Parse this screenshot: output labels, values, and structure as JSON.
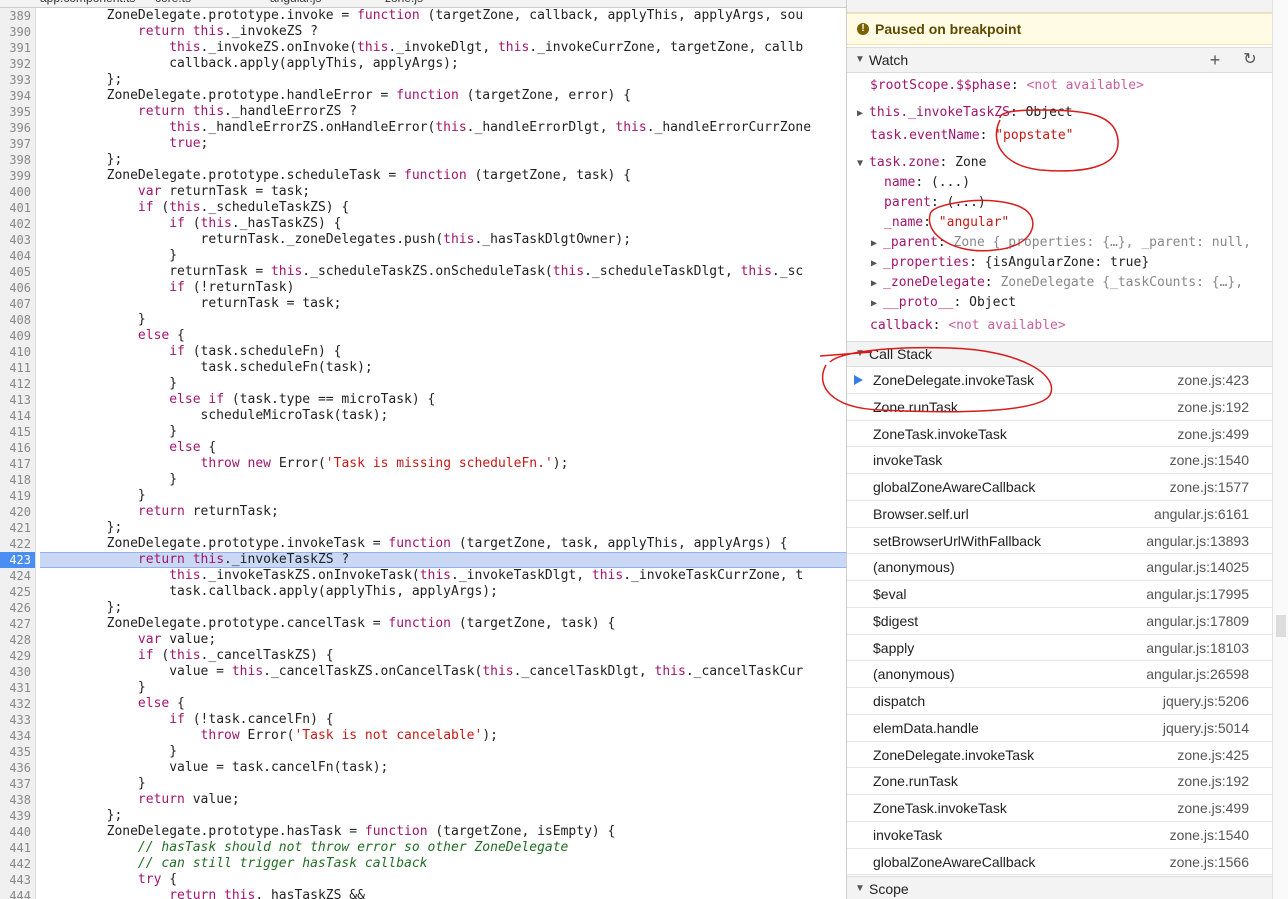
{
  "editor": {
    "tabs": [
      "app.component.ts",
      "core.ts",
      "angular.js",
      "zone.js"
    ],
    "current_line": "423",
    "lines": [
      {
        "n": "389",
        "segs": [
          [
            "fn",
            "        "
          ],
          [
            "fn",
            "ZoneDelegate.prototype.invoke = "
          ],
          [
            "kw",
            "function"
          ],
          [
            "fn",
            " (targetZone, callback, applyThis, applyArgs, sou"
          ]
        ]
      },
      {
        "n": "390",
        "segs": [
          [
            "fn",
            "            "
          ],
          [
            "kw",
            "return"
          ],
          [
            "fn",
            " "
          ],
          [
            "kw",
            "this"
          ],
          [
            "fn",
            "._invokeZS ?"
          ]
        ]
      },
      {
        "n": "391",
        "segs": [
          [
            "fn",
            "                "
          ],
          [
            "kw",
            "this"
          ],
          [
            "fn",
            "._invokeZS.onInvoke("
          ],
          [
            "kw",
            "this"
          ],
          [
            "fn",
            "._invokeDlgt, "
          ],
          [
            "kw",
            "this"
          ],
          [
            "fn",
            "._invokeCurrZone, targetZone, callb"
          ]
        ]
      },
      {
        "n": "392",
        "segs": [
          [
            "fn",
            "                callback.apply(applyThis, applyArgs);"
          ]
        ]
      },
      {
        "n": "393",
        "segs": [
          [
            "fn",
            "        };"
          ]
        ]
      },
      {
        "n": "394",
        "segs": [
          [
            "fn",
            "        ZoneDelegate.prototype.handleError = "
          ],
          [
            "kw",
            "function"
          ],
          [
            "fn",
            " (targetZone, error) {"
          ]
        ]
      },
      {
        "n": "395",
        "segs": [
          [
            "fn",
            "            "
          ],
          [
            "kw",
            "return"
          ],
          [
            "fn",
            " "
          ],
          [
            "kw",
            "this"
          ],
          [
            "fn",
            "._handleErrorZS ?"
          ]
        ]
      },
      {
        "n": "396",
        "segs": [
          [
            "fn",
            "                "
          ],
          [
            "kw",
            "this"
          ],
          [
            "fn",
            "._handleErrorZS.onHandleError("
          ],
          [
            "kw",
            "this"
          ],
          [
            "fn",
            "._handleErrorDlgt, "
          ],
          [
            "kw",
            "this"
          ],
          [
            "fn",
            "._handleErrorCurrZone"
          ]
        ]
      },
      {
        "n": "397",
        "segs": [
          [
            "fn",
            "                "
          ],
          [
            "kw",
            "true"
          ],
          [
            "fn",
            ";"
          ]
        ]
      },
      {
        "n": "398",
        "segs": [
          [
            "fn",
            "        };"
          ]
        ]
      },
      {
        "n": "399",
        "segs": [
          [
            "fn",
            "        ZoneDelegate.prototype.scheduleTask = "
          ],
          [
            "kw",
            "function"
          ],
          [
            "fn",
            " (targetZone, task) {"
          ]
        ]
      },
      {
        "n": "400",
        "segs": [
          [
            "fn",
            "            "
          ],
          [
            "kw",
            "var"
          ],
          [
            "fn",
            " returnTask = task;"
          ]
        ]
      },
      {
        "n": "401",
        "segs": [
          [
            "fn",
            "            "
          ],
          [
            "kw",
            "if"
          ],
          [
            "fn",
            " ("
          ],
          [
            "kw",
            "this"
          ],
          [
            "fn",
            "._scheduleTaskZS) {"
          ]
        ]
      },
      {
        "n": "402",
        "segs": [
          [
            "fn",
            "                "
          ],
          [
            "kw",
            "if"
          ],
          [
            "fn",
            " ("
          ],
          [
            "kw",
            "this"
          ],
          [
            "fn",
            "._hasTaskZS) {"
          ]
        ]
      },
      {
        "n": "403",
        "segs": [
          [
            "fn",
            "                    returnTask._zoneDelegates.push("
          ],
          [
            "kw",
            "this"
          ],
          [
            "fn",
            "._hasTaskDlgtOwner);"
          ]
        ]
      },
      {
        "n": "404",
        "segs": [
          [
            "fn",
            "                }"
          ]
        ]
      },
      {
        "n": "405",
        "segs": [
          [
            "fn",
            "                returnTask = "
          ],
          [
            "kw",
            "this"
          ],
          [
            "fn",
            "._scheduleTaskZS.onScheduleTask("
          ],
          [
            "kw",
            "this"
          ],
          [
            "fn",
            "._scheduleTaskDlgt, "
          ],
          [
            "kw",
            "this"
          ],
          [
            "fn",
            "._sc"
          ]
        ]
      },
      {
        "n": "406",
        "segs": [
          [
            "fn",
            "                "
          ],
          [
            "kw",
            "if"
          ],
          [
            "fn",
            " (!returnTask)"
          ]
        ]
      },
      {
        "n": "407",
        "segs": [
          [
            "fn",
            "                    returnTask = task;"
          ]
        ]
      },
      {
        "n": "408",
        "segs": [
          [
            "fn",
            "            }"
          ]
        ]
      },
      {
        "n": "409",
        "segs": [
          [
            "fn",
            "            "
          ],
          [
            "kw",
            "else"
          ],
          [
            "fn",
            " {"
          ]
        ]
      },
      {
        "n": "410",
        "segs": [
          [
            "fn",
            "                "
          ],
          [
            "kw",
            "if"
          ],
          [
            "fn",
            " (task.scheduleFn) {"
          ]
        ]
      },
      {
        "n": "411",
        "segs": [
          [
            "fn",
            "                    task.scheduleFn(task);"
          ]
        ]
      },
      {
        "n": "412",
        "segs": [
          [
            "fn",
            "                }"
          ]
        ]
      },
      {
        "n": "413",
        "segs": [
          [
            "fn",
            "                "
          ],
          [
            "kw",
            "else if"
          ],
          [
            "fn",
            " (task.type == microTask) {"
          ]
        ]
      },
      {
        "n": "414",
        "segs": [
          [
            "fn",
            "                    scheduleMicroTask(task);"
          ]
        ]
      },
      {
        "n": "415",
        "segs": [
          [
            "fn",
            "                }"
          ]
        ]
      },
      {
        "n": "416",
        "segs": [
          [
            "fn",
            "                "
          ],
          [
            "kw",
            "else"
          ],
          [
            "fn",
            " {"
          ]
        ]
      },
      {
        "n": "417",
        "segs": [
          [
            "fn",
            "                    "
          ],
          [
            "kw",
            "throw new"
          ],
          [
            "fn",
            " Error("
          ],
          [
            "str",
            "'Task is missing scheduleFn.'"
          ],
          [
            "fn",
            ");"
          ]
        ]
      },
      {
        "n": "418",
        "segs": [
          [
            "fn",
            "                }"
          ]
        ]
      },
      {
        "n": "419",
        "segs": [
          [
            "fn",
            "            }"
          ]
        ]
      },
      {
        "n": "420",
        "segs": [
          [
            "fn",
            "            "
          ],
          [
            "kw",
            "return"
          ],
          [
            "fn",
            " returnTask;"
          ]
        ]
      },
      {
        "n": "421",
        "segs": [
          [
            "fn",
            "        };"
          ]
        ]
      },
      {
        "n": "422",
        "segs": [
          [
            "fn",
            "        ZoneDelegate.prototype.invokeTask = "
          ],
          [
            "kw",
            "function"
          ],
          [
            "fn",
            " (targetZone, task, applyThis, applyArgs) {"
          ]
        ]
      },
      {
        "n": "423",
        "segs": [
          [
            "fn",
            "            "
          ],
          [
            "kw",
            "return"
          ],
          [
            "fn",
            " "
          ],
          [
            "kw",
            "this"
          ],
          [
            "fn",
            "._invokeTaskZS ?"
          ]
        ]
      },
      {
        "n": "424",
        "segs": [
          [
            "fn",
            "                "
          ],
          [
            "kw",
            "this"
          ],
          [
            "fn",
            "._invokeTaskZS.onInvokeTask("
          ],
          [
            "kw",
            "this"
          ],
          [
            "fn",
            "._invokeTaskDlgt, "
          ],
          [
            "kw",
            "this"
          ],
          [
            "fn",
            "._invokeTaskCurrZone, t"
          ]
        ]
      },
      {
        "n": "425",
        "segs": [
          [
            "fn",
            "                task.callback.apply(applyThis, applyArgs);"
          ]
        ]
      },
      {
        "n": "426",
        "segs": [
          [
            "fn",
            "        };"
          ]
        ]
      },
      {
        "n": "427",
        "segs": [
          [
            "fn",
            "        ZoneDelegate.prototype.cancelTask = "
          ],
          [
            "kw",
            "function"
          ],
          [
            "fn",
            " (targetZone, task) {"
          ]
        ]
      },
      {
        "n": "428",
        "segs": [
          [
            "fn",
            "            "
          ],
          [
            "kw",
            "var"
          ],
          [
            "fn",
            " value;"
          ]
        ]
      },
      {
        "n": "429",
        "segs": [
          [
            "fn",
            "            "
          ],
          [
            "kw",
            "if"
          ],
          [
            "fn",
            " ("
          ],
          [
            "kw",
            "this"
          ],
          [
            "fn",
            "._cancelTaskZS) {"
          ]
        ]
      },
      {
        "n": "430",
        "segs": [
          [
            "fn",
            "                value = "
          ],
          [
            "kw",
            "this"
          ],
          [
            "fn",
            "._cancelTaskZS.onCancelTask("
          ],
          [
            "kw",
            "this"
          ],
          [
            "fn",
            "._cancelTaskDlgt, "
          ],
          [
            "kw",
            "this"
          ],
          [
            "fn",
            "._cancelTaskCur"
          ]
        ]
      },
      {
        "n": "431",
        "segs": [
          [
            "fn",
            "            }"
          ]
        ]
      },
      {
        "n": "432",
        "segs": [
          [
            "fn",
            "            "
          ],
          [
            "kw",
            "else"
          ],
          [
            "fn",
            " {"
          ]
        ]
      },
      {
        "n": "433",
        "segs": [
          [
            "fn",
            "                "
          ],
          [
            "kw",
            "if"
          ],
          [
            "fn",
            " (!task.cancelFn) {"
          ]
        ]
      },
      {
        "n": "434",
        "segs": [
          [
            "fn",
            "                    "
          ],
          [
            "kw",
            "throw"
          ],
          [
            "fn",
            " Error("
          ],
          [
            "str",
            "'Task is not cancelable'"
          ],
          [
            "fn",
            ");"
          ]
        ]
      },
      {
        "n": "435",
        "segs": [
          [
            "fn",
            "                }"
          ]
        ]
      },
      {
        "n": "436",
        "segs": [
          [
            "fn",
            "                value = task.cancelFn(task);"
          ]
        ]
      },
      {
        "n": "437",
        "segs": [
          [
            "fn",
            "            }"
          ]
        ]
      },
      {
        "n": "438",
        "segs": [
          [
            "fn",
            "            "
          ],
          [
            "kw",
            "return"
          ],
          [
            "fn",
            " value;"
          ]
        ]
      },
      {
        "n": "439",
        "segs": [
          [
            "fn",
            "        };"
          ]
        ]
      },
      {
        "n": "440",
        "segs": [
          [
            "fn",
            "        ZoneDelegate.prototype.hasTask = "
          ],
          [
            "kw",
            "function"
          ],
          [
            "fn",
            " (targetZone, isEmpty) {"
          ]
        ]
      },
      {
        "n": "441",
        "segs": [
          [
            "fn",
            "            "
          ],
          [
            "cmt",
            "// hasTask should not throw error so other ZoneDelegate"
          ]
        ]
      },
      {
        "n": "442",
        "segs": [
          [
            "fn",
            "            "
          ],
          [
            "cmt",
            "// can still trigger hasTask callback"
          ]
        ]
      },
      {
        "n": "443",
        "segs": [
          [
            "fn",
            "            "
          ],
          [
            "kw",
            "try"
          ],
          [
            "fn",
            " {"
          ]
        ]
      },
      {
        "n": "444",
        "segs": [
          [
            "fn",
            "                "
          ],
          [
            "kw",
            "return this"
          ],
          [
            "fn",
            "._hasTaskZS &&"
          ]
        ]
      }
    ]
  },
  "debugger": {
    "paused_text": "Paused on breakpoint",
    "watch": {
      "title": "Watch",
      "add_label": "+",
      "refresh_label": "↻",
      "rootscope_key": "$rootScope.$$phase",
      "rootscope_val": "<not available>",
      "invoke_key": "this._invokeTaskZS",
      "invoke_val": "Object",
      "event_key": "task.eventName",
      "event_val": "\"popstate\"",
      "zone_key": "task.zone",
      "zone_val": "Zone",
      "name_key": "name",
      "name_val": "(...)",
      "parent_key": "parent",
      "parent_val": "(...)",
      "_name_key": "_name",
      "_name_val": "\"angular\"",
      "_parent_key": "_parent",
      "_parent_val": "Zone {_properties: {…}, _parent: null,",
      "_properties_key": "_properties",
      "_properties_val": "{isAngularZone: true}",
      "_zoneDelegate_key": "_zoneDelegate",
      "_zoneDelegate_val": "ZoneDelegate {_taskCounts: {…},",
      "proto_key": "__proto__",
      "proto_val": "Object",
      "callback_key": "callback",
      "callback_val": "<not available>"
    },
    "call_stack": {
      "title": "Call Stack",
      "frames": [
        {
          "name": "ZoneDelegate.invokeTask",
          "loc": "zone.js:423"
        },
        {
          "name": "Zone.runTask",
          "loc": "zone.js:192"
        },
        {
          "name": "ZoneTask.invokeTask",
          "loc": "zone.js:499"
        },
        {
          "name": "invokeTask",
          "loc": "zone.js:1540"
        },
        {
          "name": "globalZoneAwareCallback",
          "loc": "zone.js:1577"
        },
        {
          "name": "Browser.self.url",
          "loc": "angular.js:6161"
        },
        {
          "name": "setBrowserUrlWithFallback",
          "loc": "angular.js:13893"
        },
        {
          "name": "(anonymous)",
          "loc": "angular.js:14025"
        },
        {
          "name": "$eval",
          "loc": "angular.js:17995"
        },
        {
          "name": "$digest",
          "loc": "angular.js:17809"
        },
        {
          "name": "$apply",
          "loc": "angular.js:18103"
        },
        {
          "name": "(anonymous)",
          "loc": "angular.js:26598"
        },
        {
          "name": "dispatch",
          "loc": "jquery.js:5206"
        },
        {
          "name": "elemData.handle",
          "loc": "jquery.js:5014"
        },
        {
          "name": "ZoneDelegate.invokeTask",
          "loc": "zone.js:425"
        },
        {
          "name": "Zone.runTask",
          "loc": "zone.js:192"
        },
        {
          "name": "ZoneTask.invokeTask",
          "loc": "zone.js:499"
        },
        {
          "name": "invokeTask",
          "loc": "zone.js:1540"
        },
        {
          "name": "globalZoneAwareCallback",
          "loc": "zone.js:1566"
        }
      ]
    },
    "scope": {
      "title": "Scope"
    }
  },
  "colors": {
    "keyword": "#a0166f",
    "string": "#c41a16",
    "comment": "#236e25",
    "breakpoint": "#4a8ef3",
    "annotation": "#d81b1b"
  }
}
